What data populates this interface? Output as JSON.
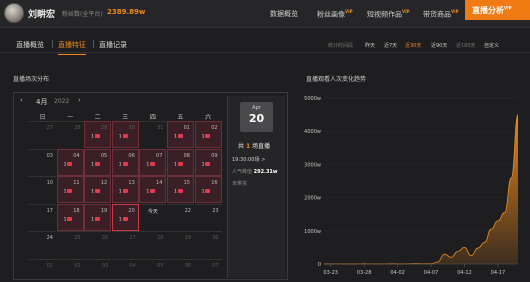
{
  "profile": {
    "name": "刘畊宏",
    "fans_label": "粉丝数(全平台)",
    "fans_value": "2389.89w"
  },
  "nav": {
    "items": [
      {
        "label": "数据概览",
        "vip": ""
      },
      {
        "label": "粉丝画像",
        "vip": "VIP"
      },
      {
        "label": "短视频作品",
        "vip": "VIP"
      },
      {
        "label": "带货商品",
        "vip": "VIP"
      }
    ],
    "active": {
      "label": "直播分析",
      "vip": "VIP"
    }
  },
  "subtabs": [
    "直播概览",
    "直播特征",
    "直播记录"
  ],
  "active_subtab": "直播特征",
  "ranges": {
    "label": "统计时间段",
    "options": [
      "昨天",
      "近7天",
      "近30天",
      "近90天",
      "近180天",
      "自定义"
    ],
    "active": "近30天",
    "disabled": [
      "近180天"
    ]
  },
  "calendar": {
    "title": "直播场次分布",
    "month": "4月",
    "year": "2022",
    "prev": "‹",
    "next": "›",
    "weekdays": [
      "日",
      "一",
      "二",
      "三",
      "四",
      "五",
      "六"
    ],
    "rows": [
      [
        {
          "d": "27",
          "dim": true
        },
        {
          "d": "28",
          "dim": true
        },
        {
          "d": "29",
          "live": 1,
          "dim": true
        },
        {
          "d": "30",
          "live": 1,
          "dim": true
        },
        {
          "d": "31",
          "dim": true
        },
        {
          "d": "01",
          "live": 1
        },
        {
          "d": "02",
          "live": 1
        }
      ],
      [
        {
          "d": "03"
        },
        {
          "d": "04",
          "live": 1
        },
        {
          "d": "05",
          "live": 1
        },
        {
          "d": "06",
          "live": 1
        },
        {
          "d": "07",
          "live": 1
        },
        {
          "d": "08",
          "live": 1
        },
        {
          "d": "09",
          "live": 1
        }
      ],
      [
        {
          "d": "10"
        },
        {
          "d": "11",
          "live": 1
        },
        {
          "d": "12",
          "live": 1
        },
        {
          "d": "13",
          "live": 1
        },
        {
          "d": "14",
          "live": 1
        },
        {
          "d": "15",
          "live": 1
        },
        {
          "d": "16",
          "live": 1
        }
      ],
      [
        {
          "d": "17"
        },
        {
          "d": "18",
          "live": 1
        },
        {
          "d": "19",
          "live": 1
        },
        {
          "d": "20",
          "live": 1,
          "today": true
        },
        {
          "d": "今天",
          "today_label": true
        },
        {
          "d": "22"
        },
        {
          "d": "23"
        }
      ],
      [
        {
          "d": "24"
        },
        {
          "d": "25",
          "dim": true
        },
        {
          "d": "26",
          "dim": true
        },
        {
          "d": "27",
          "dim": true
        },
        {
          "d": "28",
          "dim": true
        },
        {
          "d": "29",
          "dim": true
        },
        {
          "d": "30",
          "dim": true
        }
      ],
      [
        {
          "d": "01",
          "dim": true
        },
        {
          "d": "02",
          "dim": true
        },
        {
          "d": "03",
          "dim": true
        },
        {
          "d": "04",
          "dim": true
        },
        {
          "d": "05",
          "dim": true
        },
        {
          "d": "06",
          "dim": true
        },
        {
          "d": "07",
          "dim": true
        }
      ]
    ]
  },
  "detail": {
    "month": "Apr",
    "day": "20",
    "count_prefix": "共",
    "count": "1",
    "count_suffix": "场直播",
    "time": "19:30:00场",
    "time_arrow": ">",
    "viewers_label": "人气峰值",
    "viewers_value": "292.31w",
    "extra": "未带货"
  },
  "chart_data": {
    "type": "area",
    "title": "直播观看人次变化趋势",
    "color": "#f08a1c",
    "yticks": [
      "0",
      "1000w",
      "2000w",
      "3000w",
      "4000w",
      "5000w"
    ],
    "ylim": [
      0,
      5000
    ],
    "xticks": [
      "03-23",
      "03-28",
      "04-02",
      "04-07",
      "04-12",
      "04-17"
    ],
    "x": [
      "03-22",
      "03-23",
      "03-24",
      "03-25",
      "03-26",
      "03-27",
      "03-28",
      "03-29",
      "03-30",
      "03-31",
      "04-01",
      "04-02",
      "04-03",
      "04-04",
      "04-05",
      "04-06",
      "04-07",
      "04-08",
      "04-09",
      "04-10",
      "04-11",
      "04-12",
      "04-13",
      "04-14",
      "04-15",
      "04-16",
      "04-17",
      "04-18",
      "04-19",
      "04-20"
    ],
    "values": [
      2,
      3,
      4,
      2,
      1,
      3,
      5,
      4,
      2,
      3,
      6,
      4,
      3,
      8,
      10,
      6,
      5,
      60,
      300,
      200,
      380,
      500,
      250,
      480,
      650,
      1050,
      1300,
      1550,
      2600,
      4500
    ]
  }
}
